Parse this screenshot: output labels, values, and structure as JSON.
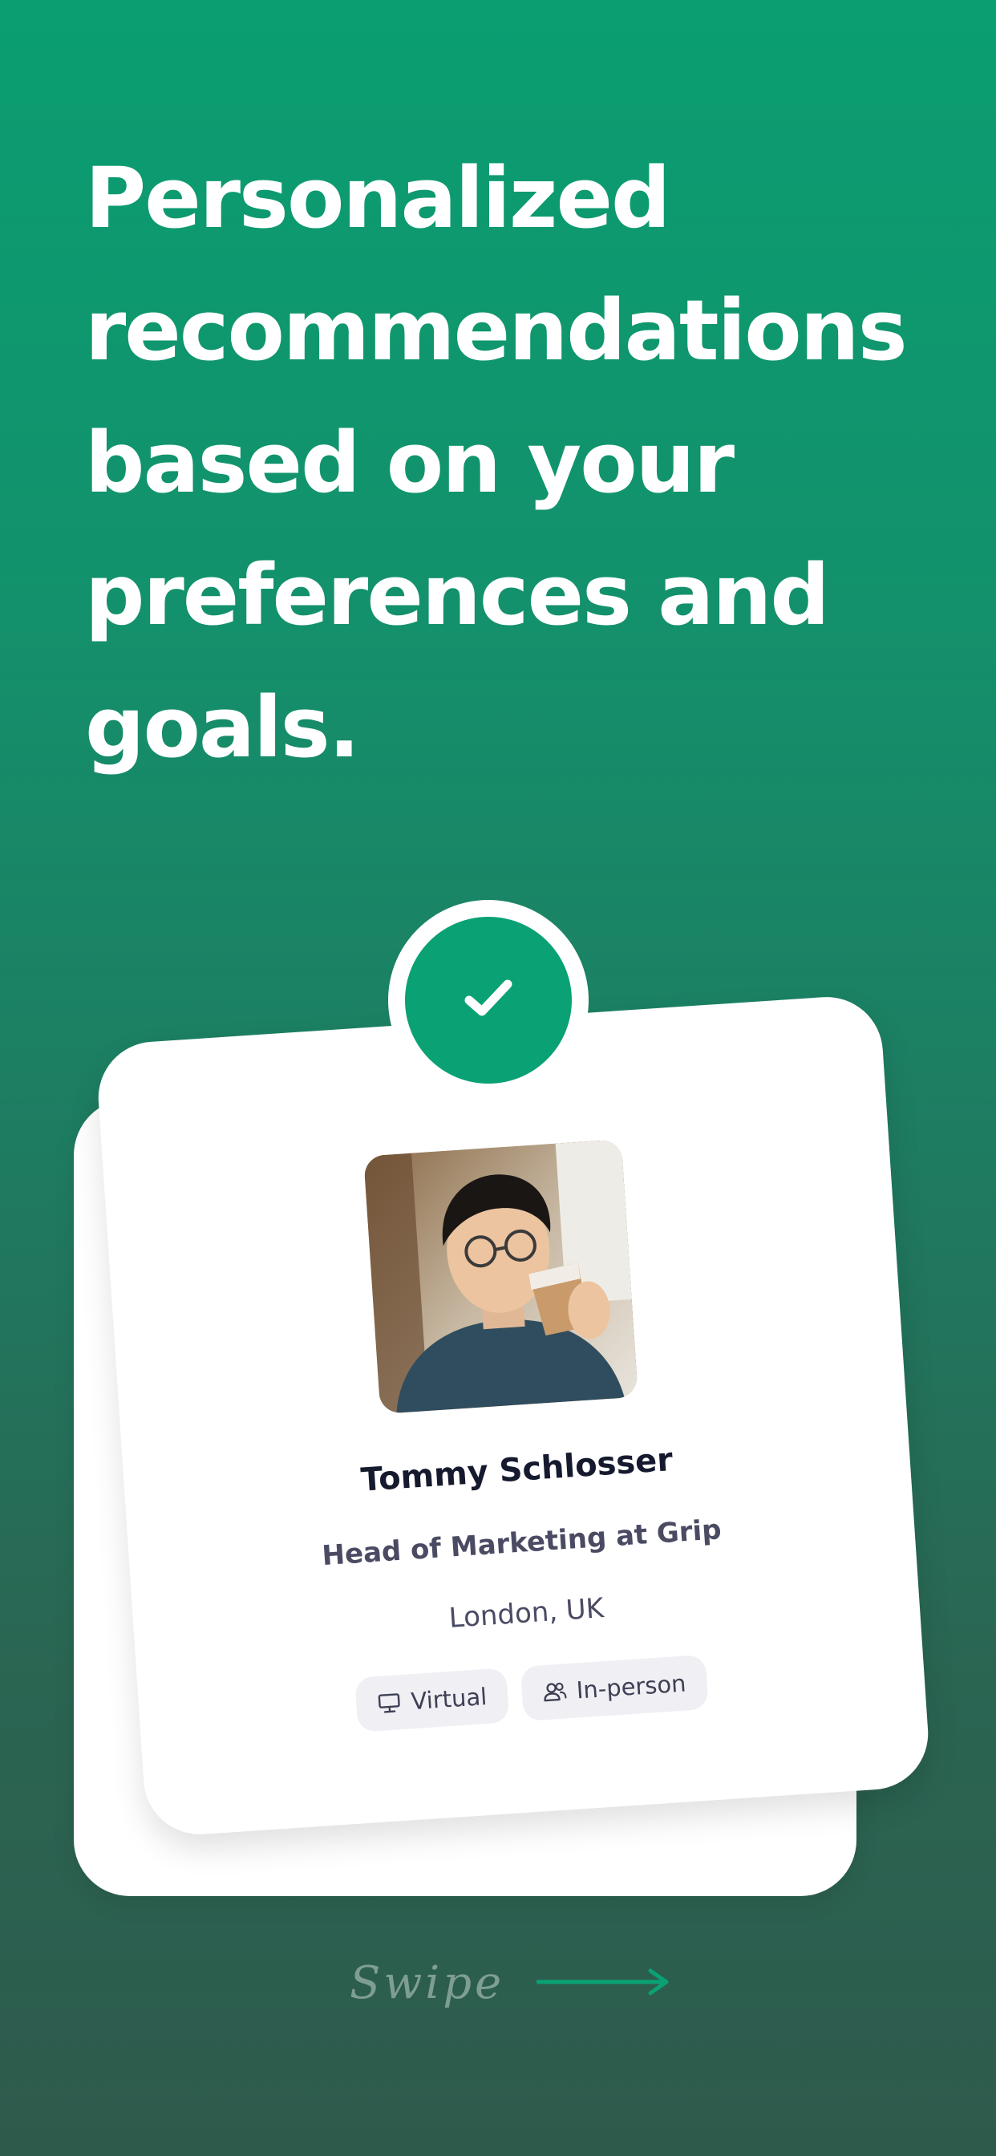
{
  "headline": {
    "lines": [
      "Personalized",
      "recommendations",
      "based on your",
      "preferences and",
      "goals."
    ]
  },
  "profile": {
    "name": "Tommy Schlosser",
    "title": "Head of Marketing at Grip",
    "location": "London, UK",
    "tags": [
      {
        "label": "Virtual",
        "icon": "monitor-icon"
      },
      {
        "label": "In-person",
        "icon": "people-icon"
      }
    ]
  },
  "badge": {
    "icon": "checkmark-icon"
  },
  "swipe": {
    "label": "Swipe",
    "icon": "arrow-right-icon"
  },
  "colors": {
    "accent": "#0aa174",
    "background_top": "#0a9e71",
    "background_bottom": "#2e5a4c",
    "text_dark": "#161a2e",
    "text_muted": "#4a4b63",
    "tag_bg": "#efeff4"
  }
}
